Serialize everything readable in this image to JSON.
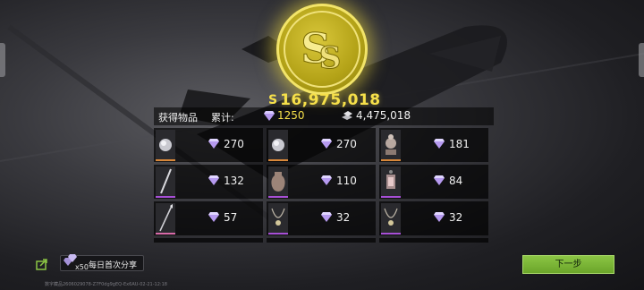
{
  "total": {
    "icon": "S",
    "value": "16,975,018"
  },
  "header": {
    "obtained_label": "获得物品",
    "cumulative_label": "累计:",
    "gem_total": "1250",
    "silver_total": "4,475,018"
  },
  "colors": {
    "gold": "#f6e04a",
    "gem": "#b69af0",
    "next_button": "#7ab536",
    "rarity_orange": "#d9883a",
    "rarity_purple": "#a74fd6",
    "rarity_pink": "#d86aa8"
  },
  "items": [
    {
      "icon": "silver-orb-icon",
      "count": "270",
      "rarity": "orange"
    },
    {
      "icon": "silver-orb-icon",
      "count": "270",
      "rarity": "orange"
    },
    {
      "icon": "ornament-statue-icon",
      "count": "181",
      "rarity": "orange"
    },
    {
      "icon": "sword-icon",
      "count": "132",
      "rarity": "purple"
    },
    {
      "icon": "vase-icon",
      "count": "110",
      "rarity": "purple"
    },
    {
      "icon": "lantern-icon",
      "count": "84",
      "rarity": "purple"
    },
    {
      "icon": "spear-icon",
      "count": "57",
      "rarity": "pink"
    },
    {
      "icon": "necklace-icon",
      "count": "32",
      "rarity": "purple"
    },
    {
      "icon": "necklace-icon",
      "count": "32",
      "rarity": "purple"
    }
  ],
  "share": {
    "quantity": "x50",
    "label": "每日首次分享"
  },
  "next_button_label": "下一步",
  "footer_id": "数字藏品2606029078-Z7F0dg9gEQ-Ex6AU-02-21-12:18"
}
